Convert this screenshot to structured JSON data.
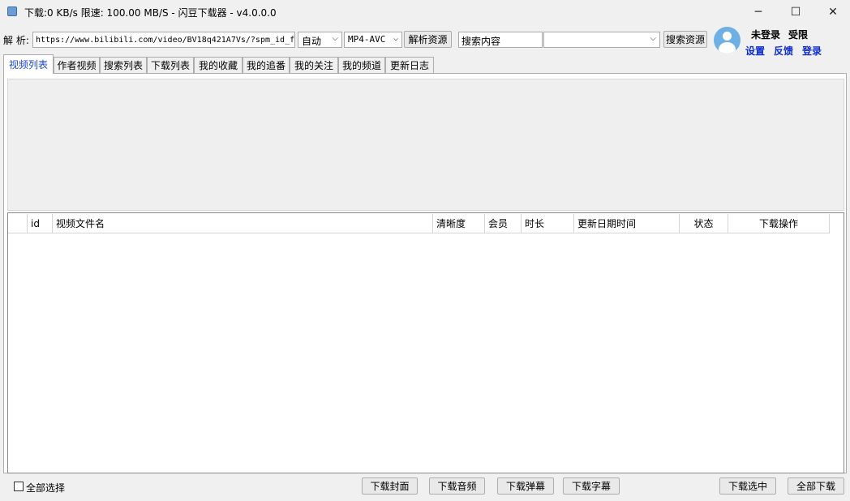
{
  "window": {
    "title": "下载:0 KB/s  限速: 100.00 MB/S  - 闪豆下载器 - v4.0.0.0",
    "minimize": "─",
    "maximize": "☐",
    "close": "✕"
  },
  "toolbar": {
    "parse_label": "解 析:",
    "url_value": "https://www.bilibili.com/video/BV18q421A7Vs/?spm_id_f",
    "quality_value": "自动",
    "format_value": "MP4-AVC",
    "parse_button": "解析资源",
    "search_value": "搜索内容",
    "search_select_value": "",
    "search_button": "搜索资源"
  },
  "user": {
    "status1": "未登录",
    "status2": "受限",
    "settings": "设置",
    "feedback": "反馈",
    "login": "登录"
  },
  "tabs": [
    {
      "label": "视频列表"
    },
    {
      "label": "作者视频"
    },
    {
      "label": "搜索列表"
    },
    {
      "label": "下载列表"
    },
    {
      "label": "我的收藏"
    },
    {
      "label": "我的追番"
    },
    {
      "label": "我的关注"
    },
    {
      "label": "我的频道"
    },
    {
      "label": "更新日志"
    }
  ],
  "table": {
    "columns": [
      "",
      "id",
      "视频文件名",
      "清晰度",
      "会员",
      "时长",
      "更新日期时间",
      "状态",
      "下载操作"
    ],
    "rows": []
  },
  "footer": {
    "select_all": "全部选择",
    "download_cover": "下载封面",
    "download_audio": "下载音频",
    "download_danmaku": "下载弹幕",
    "download_subtitle": "下载字幕",
    "download_selected": "下载选中",
    "download_all": "全部下载"
  },
  "colors": {
    "link": "#0c2cd6",
    "active_tab_text": "#1a45c8",
    "avatar": "#6cb0e6"
  },
  "icons": {
    "app": "app-icon",
    "avatar": "user-avatar-icon"
  }
}
